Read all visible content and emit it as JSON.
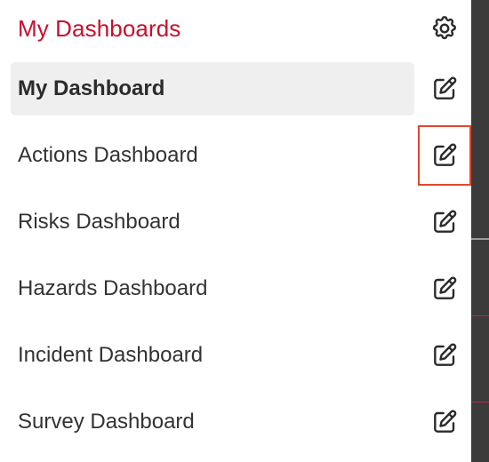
{
  "panel": {
    "title": "My Dashboards",
    "settings_icon": "gear-icon",
    "edit_icon": "edit-icon",
    "title_color": "#c8102e",
    "highlight_color": "#e0482a"
  },
  "dashboards": [
    {
      "label": "My Dashboard",
      "active": true,
      "edit_highlighted": false
    },
    {
      "label": "Actions Dashboard",
      "active": false,
      "edit_highlighted": true
    },
    {
      "label": "Risks Dashboard",
      "active": false,
      "edit_highlighted": false
    },
    {
      "label": "Hazards Dashboard",
      "active": false,
      "edit_highlighted": false
    },
    {
      "label": "Incident Dashboard",
      "active": false,
      "edit_highlighted": false
    },
    {
      "label": "Survey Dashboard",
      "active": false,
      "edit_highlighted": false
    }
  ]
}
